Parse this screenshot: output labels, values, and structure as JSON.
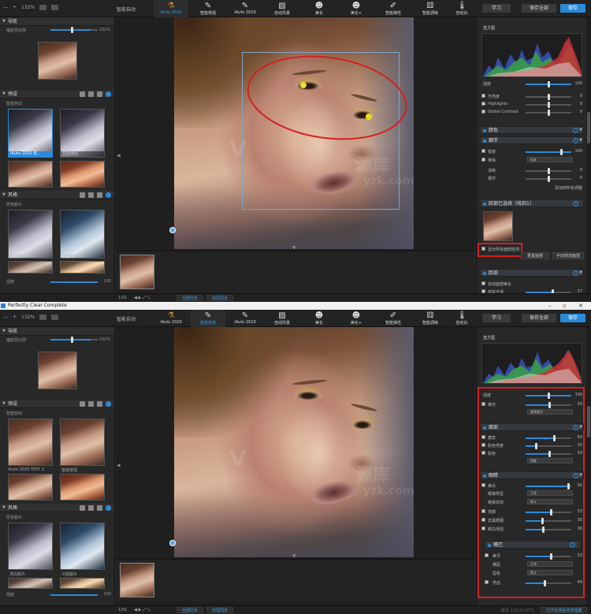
{
  "window_title": "Perfectly Clear Complete",
  "toolbar": {
    "zoom": "132%",
    "smart_auto": "智能自动",
    "tools": [
      {
        "label": "iAuto 2020",
        "icon": "flask-icon"
      },
      {
        "label": "智能增强",
        "icon": "brush-icon"
      },
      {
        "label": "iAuto 2019",
        "icon": "brush-icon"
      },
      {
        "label": "自动风景",
        "icon": "landscape-icon"
      },
      {
        "label": "美化",
        "icon": "face-icon"
      },
      {
        "label": "美化+",
        "icon": "face-plus-icon"
      },
      {
        "label": "智能弹性",
        "icon": "pen-icon"
      },
      {
        "label": "智能调噪",
        "icon": "dice-icon"
      },
      {
        "label": "自动白",
        "icon": "thermometer-icon"
      }
    ],
    "learn": "学习",
    "save_all": "保存全部",
    "save": "保存"
  },
  "left": {
    "nav_title": "导航",
    "nav_zoom_label": "缩放至比例",
    "nav_zoom_value": "132%",
    "nav_zoom_fraction": 0.85,
    "presets_title": "预设",
    "group_smart": "智能自动",
    "preset_a_top": "iAuto 2020 预...",
    "preset_a_bottom": "iAuto 2020 TEST 2",
    "preset_b": "智能增强",
    "looks_title": "风格",
    "looks_group": "原色胶片",
    "look_a": "漂白胶片",
    "look_b": "冷蓝胶片",
    "strength_label": "强度",
    "strength_value": "100",
    "strength_fraction": 1.0
  },
  "status": {
    "count": "1/01",
    "btn_all": "全部同步",
    "btn_sync": "向前同步",
    "version": "版本 3.11.0.1871",
    "open_settings": "打开应用程序管理器"
  },
  "right_top": {
    "histogram_title": "直方图",
    "strength_label": "强度",
    "strength_value": "100",
    "rows_top": [
      {
        "label": "光亮度",
        "value": "0"
      },
      {
        "label": "Highlights",
        "value": "0"
      },
      {
        "label": "Global Contrast",
        "value": "0"
      }
    ],
    "sec_color": "颜色",
    "sec_details": "细节",
    "detail_rows": [
      {
        "label": "锐度",
        "value": "100"
      },
      {
        "label": "降噪",
        "value": "标准"
      },
      {
        "label": "清晰",
        "value": "0"
      },
      {
        "label": "细节",
        "value": "0"
      }
    ],
    "auto_detail": "添加到所有调整",
    "face_title": "脸部已选择（找到1）",
    "face_checkbox": "显示所有面部检测",
    "face_reset": "重置面部",
    "face_manual": "手动增加面部",
    "sec_skin": "脸部",
    "skin_rows": [
      {
        "label": "自动面部美化",
        "value": ""
      },
      {
        "label": "皮肤平滑",
        "value": "57"
      }
    ]
  },
  "right_bottom": {
    "histogram_title": "直方图",
    "strength_label": "强度",
    "strength_value": "100",
    "exposure_label": "曝光",
    "exposure_value": "50",
    "exposure_drop": "美景模式",
    "sec_face": "面部",
    "face_rows": [
      {
        "label": "磨皮",
        "value": "60"
      },
      {
        "label": "肤色亮度",
        "value": "20"
      },
      {
        "label": "肤色",
        "value": "50"
      }
    ],
    "face_drop": "智能",
    "sec_eyes": "眼睛",
    "eye_rows": [
      {
        "label": "美白",
        "value": "91"
      },
      {
        "label": "眼袋类型",
        "value": "正常"
      },
      {
        "label": "眼袋去除",
        "value": "默认"
      },
      {
        "label": "亮眼",
        "value": "53"
      },
      {
        "label": "去黑眼圈",
        "value": "35"
      },
      {
        "label": "眼白增强",
        "value": "36"
      }
    ],
    "sec_mouth": "嘴巴",
    "mouth_rows": [
      {
        "label": "美牙",
        "value": "53"
      },
      {
        "label": "嘴唇",
        "value": "正常"
      },
      {
        "label": "唇色",
        "value": "默认"
      },
      {
        "label": "亮齿",
        "value": "40"
      }
    ]
  },
  "watermark": "源库",
  "watermark_url": "yzk.com"
}
